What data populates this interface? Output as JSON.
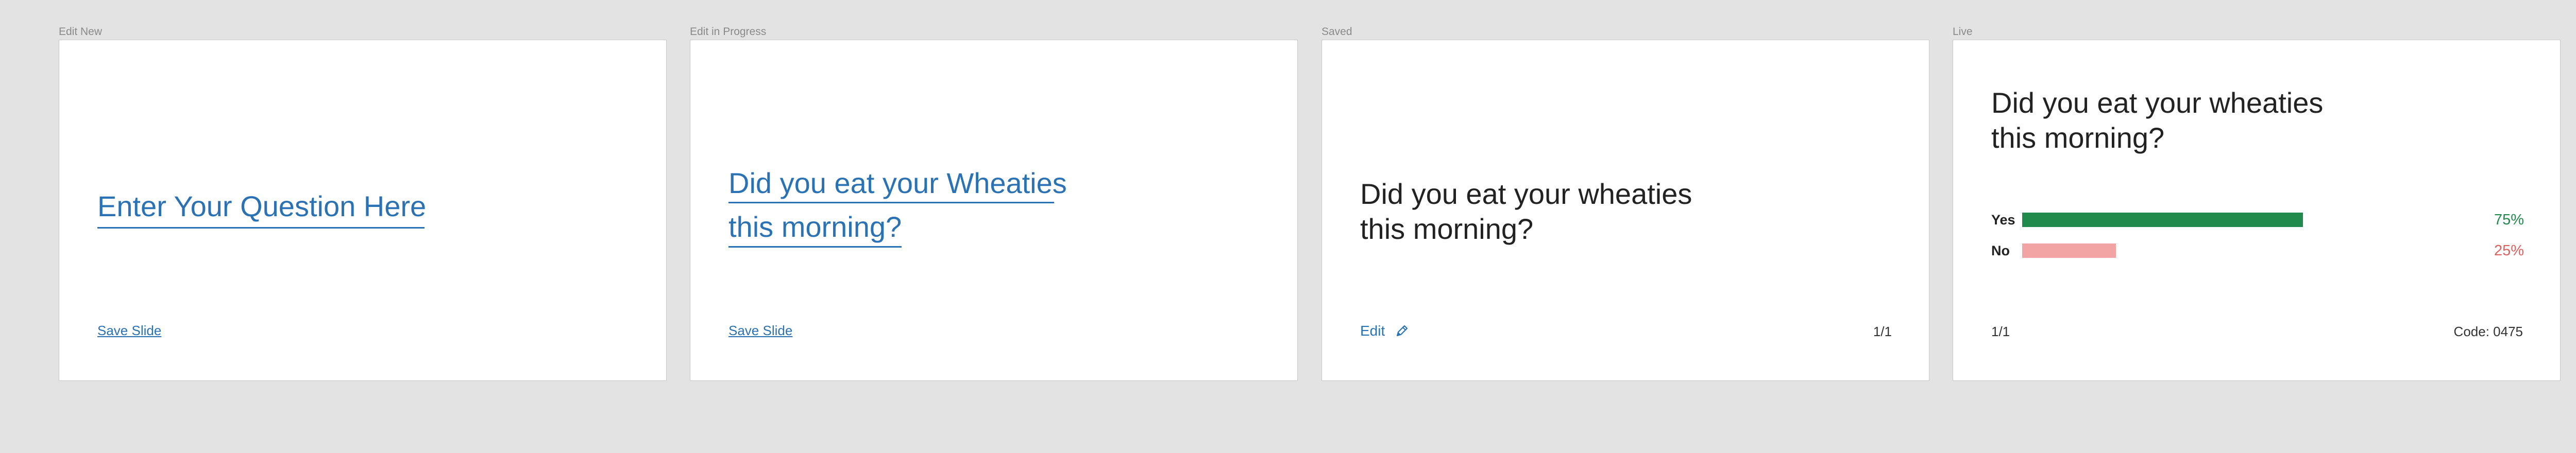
{
  "panels": {
    "edit_new": {
      "label": "Edit  New",
      "question_placeholder": "Enter Your Question Here",
      "save_label": "Save Slide"
    },
    "edit_in_progress": {
      "label": "Edit in Progress",
      "question_line1": "Did you eat your Wheaties",
      "question_line2": "this morning?",
      "save_label": "Save Slide"
    },
    "saved": {
      "label": "Saved",
      "question": "Did you eat your wheaties\nthis morning?",
      "edit_label": "Edit",
      "edit_icon": "pencil-icon",
      "page_count": "1/1"
    },
    "live": {
      "label": "Live",
      "question": "Did you eat your wheaties\nthis morning?",
      "results": [
        {
          "label": "Yes",
          "percent_text": "75%",
          "fraction": 0.75,
          "bar_color": "#1f8a4c",
          "text_color": "#1f8a4c"
        },
        {
          "label": "No",
          "percent_text": "25%",
          "fraction": 0.25,
          "bar_color": "#f2a3a3",
          "text_color": "#e06060"
        }
      ],
      "page_count": "1/1",
      "code": "Code: 0475"
    }
  },
  "colors": {
    "accent": "#2b72b4",
    "background": "#e3e3e3",
    "card": "#ffffff"
  }
}
